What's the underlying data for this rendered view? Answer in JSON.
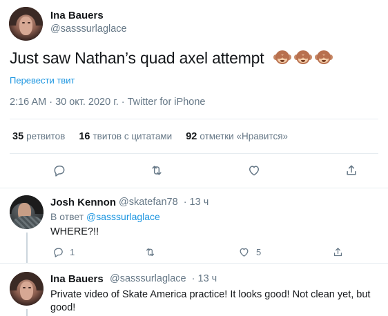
{
  "main_tweet": {
    "author_name": "Ina Bauers",
    "author_handle": "@sasssurlaglace",
    "text": "Just saw Nathan’s quad axel attempt",
    "emojis": [
      "see-no-evil-monkey",
      "see-no-evil-monkey",
      "see-no-evil-monkey"
    ],
    "translate_label": "Перевести твит",
    "timestamp": "2:16 AM · 30 окт. 2020 г. · Twitter for iPhone",
    "stats": [
      {
        "count": "35",
        "label": "ретвитов"
      },
      {
        "count": "16",
        "label": "твитов с цитатами"
      },
      {
        "count": "92",
        "label": "отметки «Нравится»"
      }
    ]
  },
  "replies": [
    {
      "author_name": "Josh Kennon",
      "author_handle": "@skatefan78",
      "time": "· 13 ч",
      "replying_prefix": "В ответ",
      "replying_to": "@sasssurlaglace",
      "text": "WHERE?!!",
      "reply_count": "1",
      "like_count": "5"
    },
    {
      "author_name": "Ina Bauers",
      "author_handle": "@sasssurlaglace",
      "time": "· 13 ч",
      "text": "Private video of Skate America practice! It looks good! Not clean yet, but good!"
    }
  ],
  "colors": {
    "link": "#1b95e0",
    "secondary_text": "#657786",
    "divider": "#e6ecf0"
  }
}
